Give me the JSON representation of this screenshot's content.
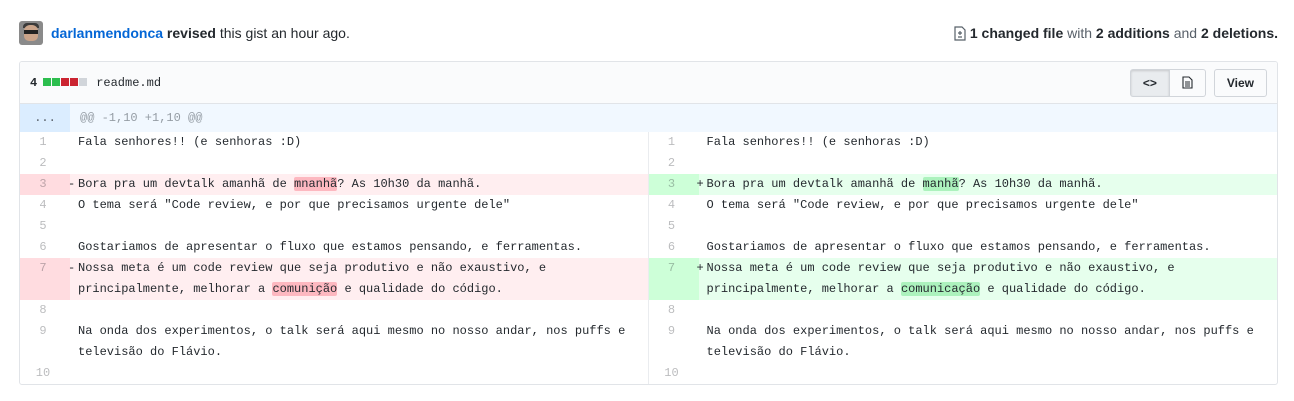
{
  "header": {
    "user": "darlanmendonca",
    "action": "revised",
    "object": "this gist an hour ago.",
    "changed_count": "1 changed file",
    "with_text": "with",
    "additions": "2 additions",
    "and_text": "and",
    "deletions": "2 deletions."
  },
  "file": {
    "diffstat_count": "4",
    "name": "readme.md",
    "view_label": "View",
    "code_icon": "<>",
    "hunk_expand": "...",
    "hunk_header": "@@ -1,10 +1,10 @@"
  },
  "left": [
    {
      "num": "1",
      "type": "ctx",
      "text": "Fala senhores!! (e senhoras :D)"
    },
    {
      "num": "2",
      "type": "ctx",
      "text": ""
    },
    {
      "num": "3",
      "type": "del",
      "pre": "Bora pra um devtalk amanhã de ",
      "hl": "mnanhã",
      "post": "? As 10h30 da manhã."
    },
    {
      "num": "4",
      "type": "ctx",
      "text": "O tema será \"Code review, e por que precisamos urgente dele\""
    },
    {
      "num": "5",
      "type": "ctx",
      "text": ""
    },
    {
      "num": "6",
      "type": "ctx",
      "text": "Gostariamos de apresentar o fluxo que estamos pensando, e ferramentas."
    },
    {
      "num": "7",
      "type": "del",
      "pre": "Nossa meta é um code review que seja produtivo e não exaustivo, e\nprincipalmente, melhorar a ",
      "hl": "comunição",
      "post": " e qualidade do código."
    },
    {
      "num": "8",
      "type": "ctx",
      "text": ""
    },
    {
      "num": "9",
      "type": "ctx",
      "text": "Na onda dos experimentos, o talk será aqui mesmo no nosso andar, nos puffs e\ntelevisão do Flávio."
    },
    {
      "num": "10",
      "type": "ctx",
      "text": ""
    }
  ],
  "right": [
    {
      "num": "1",
      "type": "ctx",
      "text": "Fala senhores!! (e senhoras :D)"
    },
    {
      "num": "2",
      "type": "ctx",
      "text": ""
    },
    {
      "num": "3",
      "type": "add",
      "pre": "Bora pra um devtalk amanhã de ",
      "hl": "manhã",
      "post": "? As 10h30 da manhã."
    },
    {
      "num": "4",
      "type": "ctx",
      "text": "O tema será \"Code review, e por que precisamos urgente dele\""
    },
    {
      "num": "5",
      "type": "ctx",
      "text": ""
    },
    {
      "num": "6",
      "type": "ctx",
      "text": "Gostariamos de apresentar o fluxo que estamos pensando, e ferramentas."
    },
    {
      "num": "7",
      "type": "add",
      "pre": "Nossa meta é um code review que seja produtivo e não exaustivo, e\nprincipalmente, melhorar a ",
      "hl": "comunicação",
      "post": " e qualidade do código."
    },
    {
      "num": "8",
      "type": "ctx",
      "text": ""
    },
    {
      "num": "9",
      "type": "ctx",
      "text": "Na onda dos experimentos, o talk será aqui mesmo no nosso andar, nos puffs e\ntelevisão do Flávio."
    },
    {
      "num": "10",
      "type": "ctx",
      "text": ""
    }
  ],
  "colors": {
    "add": "#2cbe4e",
    "del": "#cb2431",
    "neutral": "#d1d5da",
    "link": "#0366d6"
  },
  "diffstat": [
    "add",
    "add",
    "del",
    "del",
    "neutral"
  ]
}
